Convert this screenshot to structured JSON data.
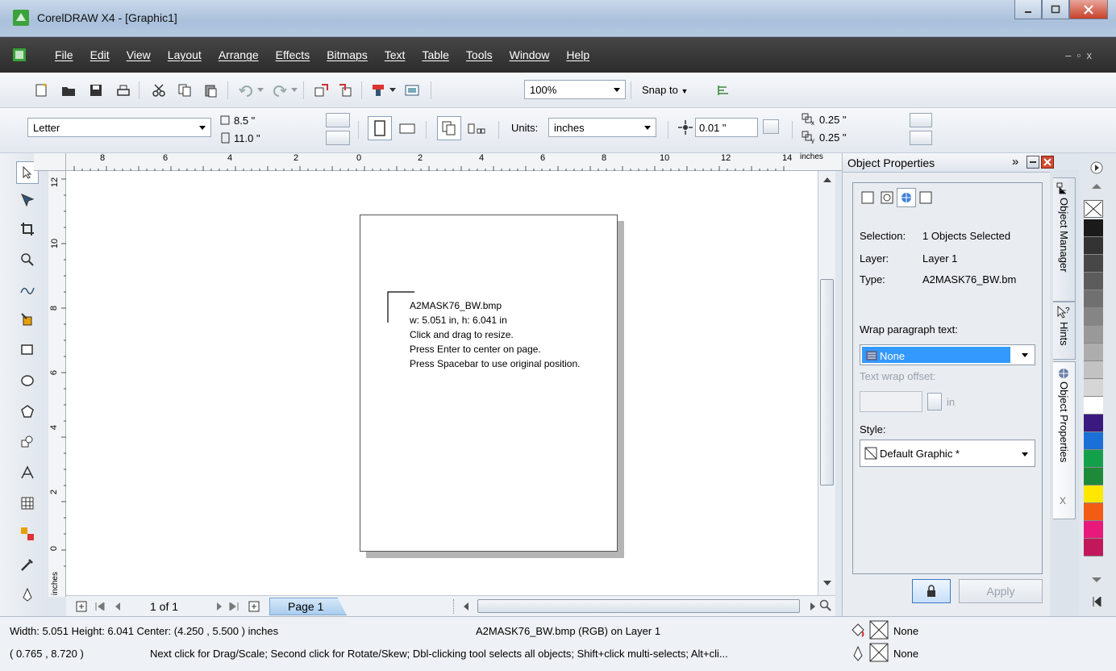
{
  "window": {
    "title": "CorelDRAW X4 - [Graphic1]"
  },
  "menu": [
    "File",
    "Edit",
    "View",
    "Layout",
    "Arrange",
    "Effects",
    "Bitmaps",
    "Text",
    "Table",
    "Tools",
    "Window",
    "Help"
  ],
  "toolbar": {
    "zoom": "100%",
    "snap_label": "Snap to"
  },
  "propbar": {
    "page_size": "Letter",
    "width": "8.5 \"",
    "height": "11.0 \"",
    "units_label": "Units:",
    "units": "inches",
    "nudge": "0.01 \"",
    "dup_x": "0.25 \"",
    "dup_y": "0.25 \""
  },
  "rulers": {
    "top_ticks": [
      "8",
      "6",
      "4",
      "2",
      "0",
      "2",
      "4",
      "6",
      "8",
      "10",
      "12",
      "14"
    ],
    "top_unit": "inches",
    "left_ticks": [
      "12",
      "10",
      "8",
      "6",
      "4",
      "2",
      "0"
    ],
    "left_unit": "inches"
  },
  "tooltip": {
    "lines": [
      "A2MASK76_BW.bmp",
      "w: 5.051 in, h: 6.041 in",
      "Click and drag to resize.",
      "Press Enter to center on page.",
      "Press Spacebar to use original position."
    ]
  },
  "pagenav": {
    "counter": "1 of 1",
    "tab": "Page 1"
  },
  "docker": {
    "title": "Object Properties",
    "selection_label": "Selection:",
    "selection_value": "1 Objects Selected",
    "layer_label": "Layer:",
    "layer_value": "Layer 1",
    "type_label": "Type:",
    "type_value": "A2MASK76_BW.bm",
    "wrap_label": "Wrap paragraph text:",
    "wrap_value": "None",
    "offset_label": "Text wrap offset:",
    "offset_unit": "in",
    "style_label": "Style:",
    "style_value": "Default Graphic *",
    "apply": "Apply"
  },
  "sidetabs": [
    "Object Manager",
    "Hints",
    "Object Properties"
  ],
  "palette": [
    "#1a1a1a",
    "#333333",
    "#474747",
    "#5c5c5c",
    "#707070",
    "#858585",
    "#999999",
    "#adadad",
    "#c2c2c2",
    "#d6d6d6",
    "#ffffff",
    "#3b1a80",
    "#1a70d6",
    "#14a04a",
    "#1d8a3a",
    "#ffe800",
    "#f25c14",
    "#e8197a",
    "#c2185b"
  ],
  "status": {
    "dimensions": "Width: 5.051  Height: 6.041  Center: (4.250 , 5.500 )  inches",
    "object": "A2MASK76_BW.bmp (RGB) on Layer 1",
    "coords": "( 0.765 , 8.720 )",
    "hint": "Next click for Drag/Scale; Second click for Rotate/Skew; Dbl-clicking tool selects all objects; Shift+click multi-selects; Alt+cli...",
    "fill": "None",
    "outline": "None"
  }
}
